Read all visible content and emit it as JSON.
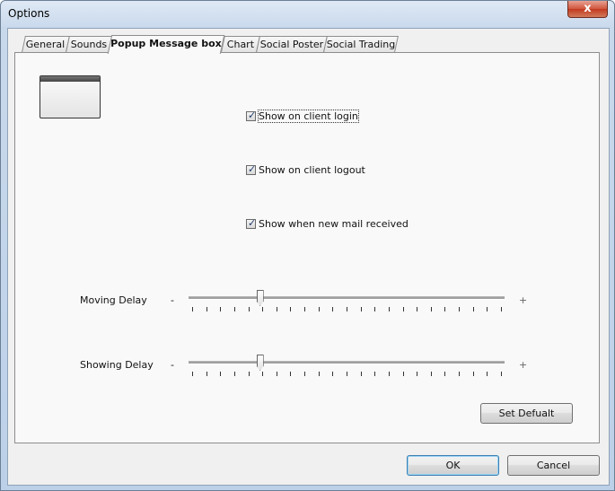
{
  "window": {
    "title": "Options",
    "close_glyph": "x"
  },
  "tabs": [
    {
      "label": "General"
    },
    {
      "label": "Sounds"
    },
    {
      "label": "Popup Message box"
    },
    {
      "label": "Chart"
    },
    {
      "label": "Social Poster"
    },
    {
      "label": "Social Trading"
    }
  ],
  "active_tab": "Popup Message box",
  "checkboxes": [
    {
      "label": "Show on client login",
      "checked": true
    },
    {
      "label": "Show on client logout",
      "checked": true
    },
    {
      "label": "Show when new mail received",
      "checked": true
    }
  ],
  "sliders": [
    {
      "label": "Moving Delay",
      "minus": "-",
      "plus": "+",
      "value_fraction": 0.22
    },
    {
      "label": "Showing Delay",
      "minus": "-",
      "plus": "+",
      "value_fraction": 0.22
    }
  ],
  "buttons": {
    "set_default": "Set Defualt",
    "ok": "OK",
    "cancel": "Cancel"
  },
  "colors": {
    "accent": "#3c7fb1",
    "close": "#c23a20"
  }
}
